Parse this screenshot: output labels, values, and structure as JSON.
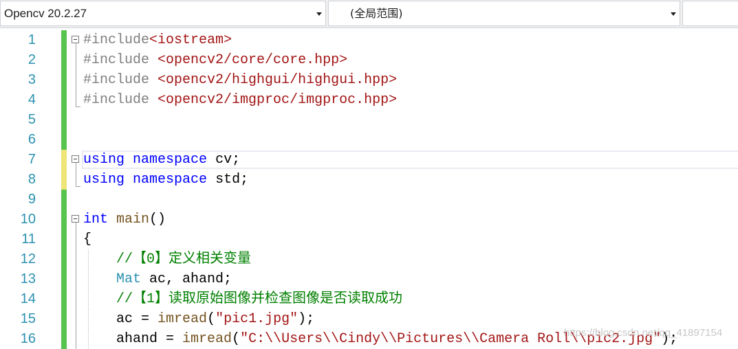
{
  "navbar": {
    "project": "Opencv 20.2.27",
    "scope": "(全局范围)",
    "member": ""
  },
  "colors": {
    "line_number": "#2b91af",
    "saved_change": "#57c44f",
    "unsaved_change": "#efe476",
    "keyword": "#0000ff",
    "string": "#a31515",
    "comment": "#008000",
    "preprocessor": "#808080",
    "type": "#2b91af"
  },
  "lines": [
    {
      "num": "1",
      "change": "saved",
      "fold": "start",
      "tokens": [
        [
          "pre",
          "#include"
        ],
        [
          "str",
          "<iostream>"
        ]
      ]
    },
    {
      "num": "2",
      "change": "saved",
      "fold": "mid",
      "tokens": [
        [
          "pre",
          "#include "
        ],
        [
          "str",
          "<opencv2/core/core.hpp>"
        ]
      ]
    },
    {
      "num": "3",
      "change": "saved",
      "fold": "mid",
      "tokens": [
        [
          "pre",
          "#include "
        ],
        [
          "str",
          "<opencv2/highgui/highgui.hpp>"
        ]
      ]
    },
    {
      "num": "4",
      "change": "saved",
      "fold": "end",
      "tokens": [
        [
          "pre",
          "#include "
        ],
        [
          "str",
          "<opencv2/imgproc/imgproc.hpp>"
        ]
      ]
    },
    {
      "num": "5",
      "change": "saved",
      "fold": "",
      "tokens": []
    },
    {
      "num": "6",
      "change": "saved",
      "fold": "",
      "tokens": []
    },
    {
      "num": "7",
      "change": "unsaved",
      "fold": "start",
      "tokens": [
        [
          "kw",
          "using"
        ],
        [
          "plain",
          " "
        ],
        [
          "kw",
          "namespace"
        ],
        [
          "plain",
          " cv;"
        ]
      ]
    },
    {
      "num": "8",
      "change": "unsaved",
      "fold": "end",
      "tokens": [
        [
          "kw",
          "using"
        ],
        [
          "plain",
          " "
        ],
        [
          "kw",
          "namespace"
        ],
        [
          "plain",
          " std;"
        ]
      ]
    },
    {
      "num": "9",
      "change": "saved",
      "fold": "",
      "tokens": []
    },
    {
      "num": "10",
      "change": "saved",
      "fold": "start",
      "tokens": [
        [
          "kw",
          "int"
        ],
        [
          "plain",
          " "
        ],
        [
          "fn",
          "main"
        ],
        [
          "plain",
          "()"
        ]
      ]
    },
    {
      "num": "11",
      "change": "saved",
      "fold": "mid",
      "tokens": [
        [
          "plain",
          "{"
        ]
      ]
    },
    {
      "num": "12",
      "change": "saved",
      "fold": "mid",
      "tokens": [
        [
          "plain",
          "    "
        ],
        [
          "cmt",
          "//【0】定义相关变量"
        ]
      ]
    },
    {
      "num": "13",
      "change": "saved",
      "fold": "mid",
      "tokens": [
        [
          "plain",
          "    "
        ],
        [
          "type",
          "Mat"
        ],
        [
          "plain",
          " ac, ahand;"
        ]
      ]
    },
    {
      "num": "14",
      "change": "saved",
      "fold": "mid",
      "tokens": [
        [
          "plain",
          "    "
        ],
        [
          "cmt",
          "//【1】读取原始图像并检查图像是否读取成功"
        ]
      ]
    },
    {
      "num": "15",
      "change": "saved",
      "fold": "mid",
      "tokens": [
        [
          "plain",
          "    ac = "
        ],
        [
          "fn",
          "imread"
        ],
        [
          "plain",
          "("
        ],
        [
          "str",
          "\"pic1.jpg\""
        ],
        [
          "plain",
          ");"
        ]
      ]
    },
    {
      "num": "16",
      "change": "saved",
      "fold": "mid",
      "tokens": [
        [
          "plain",
          "    ahand = "
        ],
        [
          "fn",
          "imread"
        ],
        [
          "plain",
          "("
        ],
        [
          "str",
          "\"C:\\\\Users\\\\Cindy\\\\Pictures\\\\Camera Roll\\\\pic2.jpg\""
        ],
        [
          "plain",
          ");"
        ]
      ]
    }
  ],
  "watermark": "https://blog.csdn.net/qq_41897154"
}
